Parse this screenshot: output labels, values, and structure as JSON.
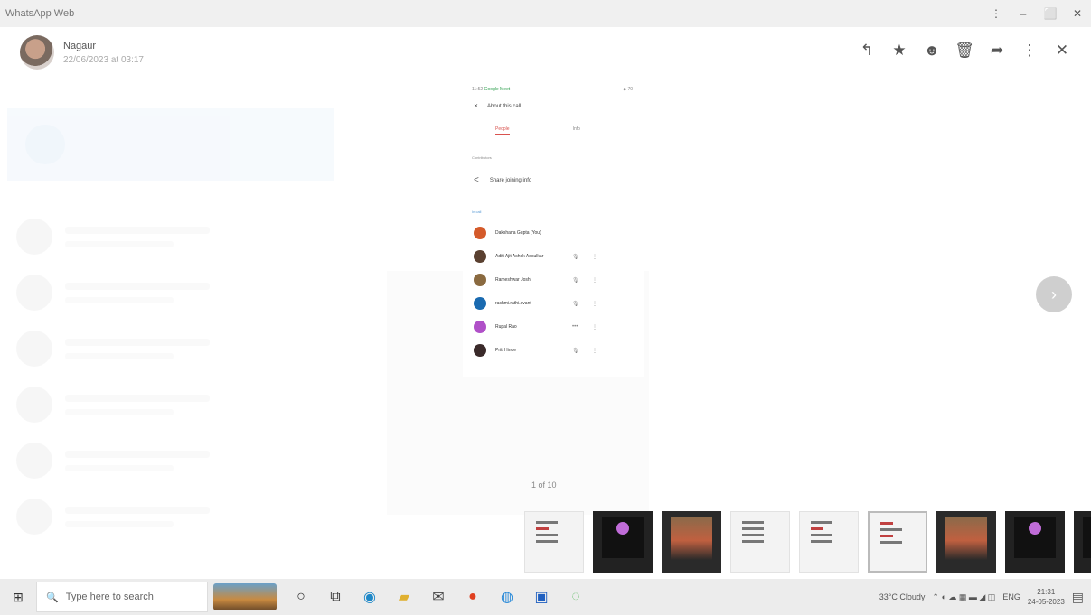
{
  "window": {
    "title": "WhatsApp Web",
    "controls": [
      "⋮",
      "–",
      "⬜",
      "✕"
    ]
  },
  "viewer": {
    "sender_name": "Nagaur",
    "sender_date": "22/06/2023 at 03:17",
    "actions": [
      {
        "icon": "reply-icon",
        "glyph": "↰"
      },
      {
        "icon": "star-icon",
        "glyph": "★"
      },
      {
        "icon": "emoji-icon",
        "glyph": "☻"
      },
      {
        "icon": "delete-icon",
        "glyph": "🗑"
      },
      {
        "icon": "forward-icon",
        "glyph": "➦"
      },
      {
        "icon": "more-icon",
        "glyph": "⋮"
      },
      {
        "icon": "close-icon",
        "glyph": "✕"
      }
    ]
  },
  "document": {
    "status_time": "11:52",
    "status_app": "Google Meet",
    "signal": "◆ 70",
    "heading": "About this call",
    "tab_people": "People",
    "tab_info": "Info",
    "section_contributors": "Contributors",
    "share_label": "Share joining info",
    "section_in_call": "In call",
    "participants": [
      {
        "name": "Dakshana Gupta (You)",
        "color": "#d45a2a",
        "mic": "",
        "more": ""
      },
      {
        "name": "Aditi Ajit Ashok Adsulkar",
        "color": "#5a4030",
        "mic": "🎙",
        "more": "⋮"
      },
      {
        "name": "Rameshwar Joshi",
        "color": "#8a6a40",
        "mic": "🎙",
        "more": "⋮"
      },
      {
        "name": "rashmi.rathi.avant",
        "color": "#1a6ab0",
        "mic": "🎙",
        "more": "⋮"
      },
      {
        "name": "Rupal Rao",
        "color": "#b050c8",
        "mic": "•••",
        "more": "⋮"
      },
      {
        "name": "Priti Hinde",
        "color": "#3a2a2a",
        "mic": "🎙",
        "more": "⋮"
      }
    ]
  },
  "page_indicator": "1 of 10",
  "next_glyph": "›",
  "thumbnails": [
    "light",
    "dark",
    "photo",
    "light",
    "light",
    "light-selected",
    "photo",
    "dark",
    "dark"
  ],
  "taskbar": {
    "start_glyph": "⊞",
    "search_icon": "🔍",
    "search_placeholder": "Type here to search",
    "apps": [
      {
        "name": "cortana-icon",
        "glyph": "○",
        "color": "#333"
      },
      {
        "name": "task-view-icon",
        "glyph": "⧉",
        "color": "#333"
      },
      {
        "name": "edge-icon",
        "glyph": "◉",
        "color": "#1e88c8"
      },
      {
        "name": "file-explorer-icon",
        "glyph": "▰",
        "color": "#e0b030"
      },
      {
        "name": "mail-icon",
        "glyph": "✉",
        "color": "#444"
      },
      {
        "name": "app-red-icon",
        "glyph": "●",
        "color": "#e04020"
      },
      {
        "name": "chrome-icon",
        "glyph": "◍",
        "color": "#2a8ad8"
      },
      {
        "name": "app-blue-icon",
        "glyph": "▣",
        "color": "#2060c0"
      },
      {
        "name": "whatsapp-icon",
        "glyph": "◌",
        "color": "#6ac070"
      }
    ],
    "weather": "33°C Cloudy",
    "tray_icons": "⌃ ◐ ☁ ▦ ▬ ◢ ◫",
    "language": "ENG",
    "time": "21:31",
    "date": "24-05-2023",
    "notification_glyph": "▤"
  }
}
